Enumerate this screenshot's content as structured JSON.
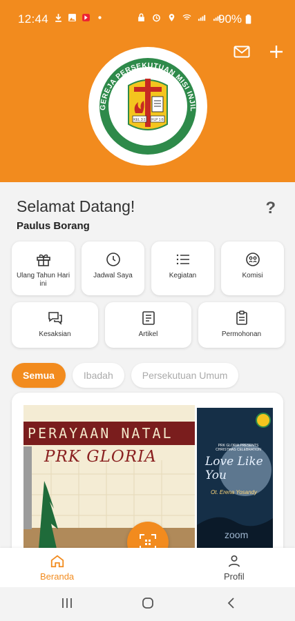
{
  "status_bar": {
    "time": "12:44",
    "battery": "90%"
  },
  "header": {
    "logo_text_top": "GEREJA PERSEKUTUAN MISI INJIL INDONESIA",
    "logo_verse_left": "KEL 3:1",
    "logo_verse_right": "FLP 1:6",
    "icons": [
      "mail-icon",
      "plus-icon"
    ]
  },
  "welcome": {
    "title": "Selamat Datang!",
    "user": "Paulus Borang",
    "help": "?"
  },
  "menu": {
    "row1": [
      {
        "label": "Ulang Tahun Hari ini",
        "icon": "gift-icon"
      },
      {
        "label": "Jadwal Saya",
        "icon": "clock-icon"
      },
      {
        "label": "Kegiatan",
        "icon": "list-icon"
      },
      {
        "label": "Komisi",
        "icon": "group-icon"
      }
    ],
    "row2": [
      {
        "label": "Kesaksian",
        "icon": "chat-icon"
      },
      {
        "label": "Artikel",
        "icon": "article-icon"
      },
      {
        "label": "Permohonan",
        "icon": "clipboard-icon"
      }
    ]
  },
  "filters": [
    {
      "label": "Semua",
      "active": true
    },
    {
      "label": "Ibadah",
      "active": false
    },
    {
      "label": "Persekutuan Umum",
      "active": false
    }
  ],
  "feed": {
    "banner_title": "PERAYAAN NATAL",
    "banner_subtitle": "PRK GLORIA",
    "poster_header": "PRK GLORIA PRESENTS CHRISTMAS CELEBRATION",
    "poster_title": "Love Like You",
    "poster_guest": "Ot. Erena Yosandy",
    "poster_footer": "zoom"
  },
  "bottom_nav": {
    "home_label": "Beranda",
    "profile_label": "Profil"
  },
  "colors": {
    "accent": "#f28b1e",
    "logo_green": "#2e8a4a",
    "logo_red": "#c62a22",
    "logo_yellow": "#f4c51e"
  }
}
